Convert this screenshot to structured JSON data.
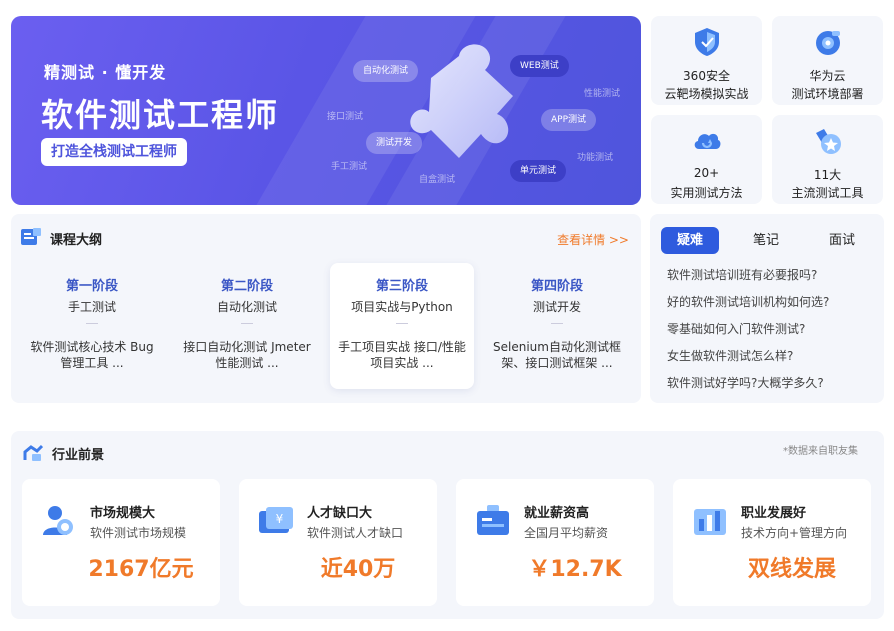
{
  "banner": {
    "subtitle": "精测试 · 懂开发",
    "title": "软件测试工程师",
    "tag": "打造全栈测试工程师",
    "chips": [
      "自动化测试",
      "WEB测试",
      "APP测试",
      "测试开发",
      "单元测试"
    ],
    "ghost_labels": [
      "性能测试",
      "接口测试",
      "功能测试",
      "手工测试",
      "自盒测试"
    ]
  },
  "features": [
    {
      "icon": "shield-icon",
      "line1": "360安全",
      "line2": "云靶场模拟实战"
    },
    {
      "icon": "camera-icon",
      "line1": "华为云",
      "line2": "测试环境部署"
    },
    {
      "icon": "cloud-icon",
      "line1": "20+",
      "line2": "实用测试方法"
    },
    {
      "icon": "star-badge-icon",
      "line1": "11大",
      "line2": "主流测试工具"
    }
  ],
  "course": {
    "title": "课程大纲",
    "more": "查看详情 >>",
    "stages": [
      {
        "name": "第一阶段",
        "topic": "手工测试",
        "desc": "软件测试核心技术 Bug管理工具 ..."
      },
      {
        "name": "第二阶段",
        "topic": "自动化测试",
        "desc": "接口自动化测试 Jmeter性能测试 ..."
      },
      {
        "name": "第三阶段",
        "topic": "项目实战与Python",
        "desc": "手工项目实战 接口/性能项目实战 ..."
      },
      {
        "name": "第四阶段",
        "topic": "测试开发",
        "desc": "Selenium自动化测试框架、接口测试框架 ..."
      }
    ]
  },
  "faq": {
    "tabs": [
      "疑难",
      "笔记",
      "面试"
    ],
    "questions": [
      "软件测试培训班有必要报吗?",
      "好的软件测试培训机构如何选?",
      "零基础如何入门软件测试?",
      "女生做软件测试怎么样?",
      "软件测试好学吗?大概学多久?"
    ]
  },
  "industry": {
    "title": "行业前景",
    "note": "*数据来自职友集",
    "cards": [
      {
        "icon": "market-icon",
        "title": "市场规模大",
        "sub": "软件测试市场规模",
        "value": "2167亿元"
      },
      {
        "icon": "talent-icon",
        "title": "人才缺口大",
        "sub": "软件测试人才缺口",
        "value": "近40万"
      },
      {
        "icon": "salary-icon",
        "title": "就业薪资高",
        "sub": "全国月平均薪资",
        "value": "￥12.7K"
      },
      {
        "icon": "growth-icon",
        "title": "职业发展好",
        "sub": "技术方向+管理方向",
        "value": "双线发展"
      }
    ]
  },
  "colors": {
    "accent": "#2e5bde",
    "orange": "#f07a2a",
    "banner": "#5a55e6",
    "panel": "#f4f6fb"
  }
}
